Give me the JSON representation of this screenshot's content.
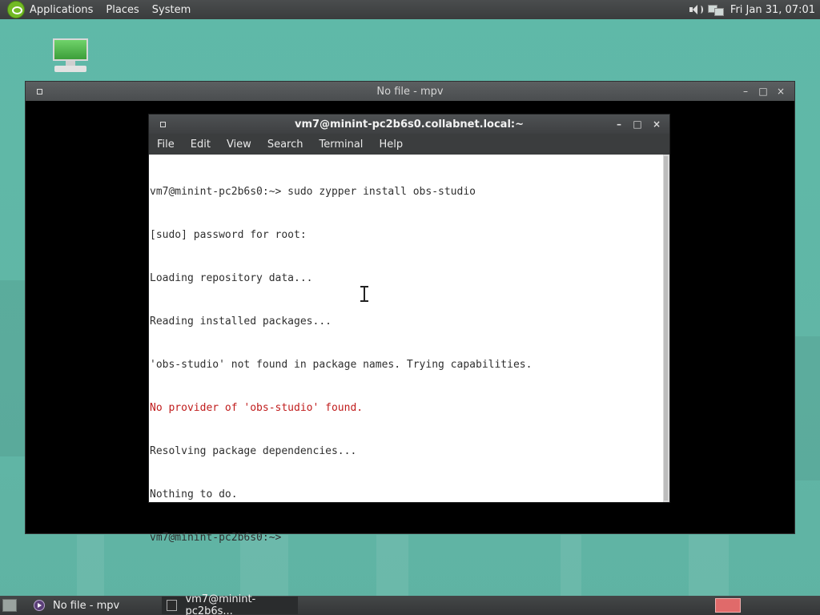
{
  "top_panel": {
    "menus": [
      "Applications",
      "Places",
      "System"
    ],
    "clock": "Fri Jan 31, 07:01"
  },
  "mpv_window": {
    "title": "No file - mpv",
    "buttons": {
      "minimize": "–",
      "maximize": "□",
      "close": "×"
    }
  },
  "terminal_window": {
    "title": "vm7@minint-pc2b6s0.collabnet.local:~",
    "buttons": {
      "minimize": "–",
      "maximize": "□",
      "close": "×"
    },
    "menu": [
      "File",
      "Edit",
      "View",
      "Search",
      "Terminal",
      "Help"
    ],
    "lines": [
      {
        "text": "vm7@minint-pc2b6s0:~> sudo zypper install obs-studio",
        "kind": "normal"
      },
      {
        "text": "[sudo] password for root:",
        "kind": "normal"
      },
      {
        "text": "Loading repository data...",
        "kind": "normal"
      },
      {
        "text": "Reading installed packages...",
        "kind": "normal"
      },
      {
        "text": "'obs-studio' not found in package names. Trying capabilities.",
        "kind": "normal"
      },
      {
        "text": "No provider of 'obs-studio' found.",
        "kind": "error"
      },
      {
        "text": "Resolving package dependencies...",
        "kind": "normal"
      },
      {
        "text": "Nothing to do.",
        "kind": "normal"
      },
      {
        "text": "vm7@minint-pc2b6s0:~> ",
        "kind": "normal"
      }
    ]
  },
  "taskbar": {
    "tasks": [
      {
        "label": "No file - mpv",
        "icon": "mpv-icon"
      },
      {
        "label": "vm7@minint-pc2b6s...",
        "icon": "terminal-icon"
      }
    ]
  },
  "colors": {
    "desktop_bg": "#5fb9a8",
    "error_text": "#c01c1c"
  }
}
